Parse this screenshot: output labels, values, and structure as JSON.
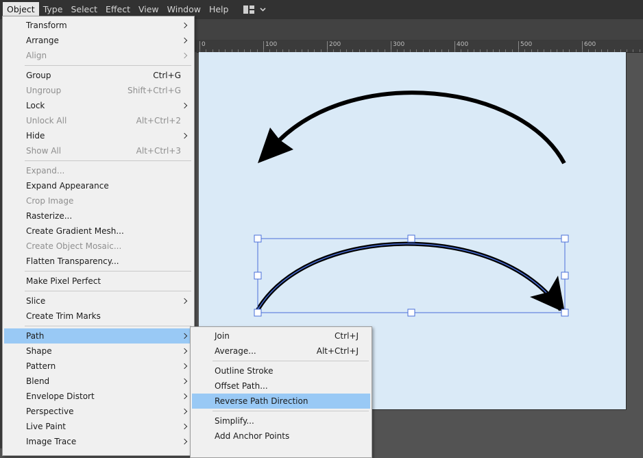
{
  "menubar": {
    "items": [
      "Object",
      "Type",
      "Select",
      "Effect",
      "View",
      "Window",
      "Help"
    ],
    "active": "Object"
  },
  "workspace_switcher_icon": "workspace-layout-icon",
  "ruler": {
    "ticks": [
      "0",
      "100",
      "200",
      "300",
      "400",
      "500",
      "600"
    ]
  },
  "object_menu": {
    "items": [
      {
        "label": "Transform",
        "shortcut": "",
        "submenu": true,
        "disabled": false
      },
      {
        "label": "Arrange",
        "shortcut": "",
        "submenu": true,
        "disabled": false
      },
      {
        "label": "Align",
        "shortcut": "",
        "submenu": true,
        "disabled": true
      },
      {
        "label": "Group",
        "shortcut": "Ctrl+G",
        "submenu": false,
        "disabled": false
      },
      {
        "label": "Ungroup",
        "shortcut": "Shift+Ctrl+G",
        "submenu": false,
        "disabled": true
      },
      {
        "label": "Lock",
        "shortcut": "",
        "submenu": true,
        "disabled": false
      },
      {
        "label": "Unlock All",
        "shortcut": "Alt+Ctrl+2",
        "submenu": false,
        "disabled": true
      },
      {
        "label": "Hide",
        "shortcut": "",
        "submenu": true,
        "disabled": false
      },
      {
        "label": "Show All",
        "shortcut": "Alt+Ctrl+3",
        "submenu": false,
        "disabled": true
      },
      {
        "label": "Expand...",
        "shortcut": "",
        "submenu": false,
        "disabled": true
      },
      {
        "label": "Expand Appearance",
        "shortcut": "",
        "submenu": false,
        "disabled": false
      },
      {
        "label": "Crop Image",
        "shortcut": "",
        "submenu": false,
        "disabled": true
      },
      {
        "label": "Rasterize...",
        "shortcut": "",
        "submenu": false,
        "disabled": false
      },
      {
        "label": "Create Gradient Mesh...",
        "shortcut": "",
        "submenu": false,
        "disabled": false
      },
      {
        "label": "Create Object Mosaic...",
        "shortcut": "",
        "submenu": false,
        "disabled": true
      },
      {
        "label": "Flatten Transparency...",
        "shortcut": "",
        "submenu": false,
        "disabled": false
      },
      {
        "label": "Make Pixel Perfect",
        "shortcut": "",
        "submenu": false,
        "disabled": false
      },
      {
        "label": "Slice",
        "shortcut": "",
        "submenu": true,
        "disabled": false
      },
      {
        "label": "Create Trim Marks",
        "shortcut": "",
        "submenu": false,
        "disabled": false
      },
      {
        "label": "Path",
        "shortcut": "",
        "submenu": true,
        "disabled": false,
        "highlighted": true
      },
      {
        "label": "Shape",
        "shortcut": "",
        "submenu": true,
        "disabled": false
      },
      {
        "label": "Pattern",
        "shortcut": "",
        "submenu": true,
        "disabled": false
      },
      {
        "label": "Blend",
        "shortcut": "",
        "submenu": true,
        "disabled": false
      },
      {
        "label": "Envelope Distort",
        "shortcut": "",
        "submenu": true,
        "disabled": false
      },
      {
        "label": "Perspective",
        "shortcut": "",
        "submenu": true,
        "disabled": false
      },
      {
        "label": "Live Paint",
        "shortcut": "",
        "submenu": true,
        "disabled": false
      },
      {
        "label": "Image Trace",
        "shortcut": "",
        "submenu": true,
        "disabled": false
      }
    ]
  },
  "path_menu": {
    "items": [
      {
        "label": "Join",
        "shortcut": "Ctrl+J",
        "disabled": false
      },
      {
        "label": "Average...",
        "shortcut": "Alt+Ctrl+J",
        "disabled": false
      },
      {
        "label": "Outline Stroke",
        "shortcut": "",
        "disabled": false
      },
      {
        "label": "Offset Path...",
        "shortcut": "",
        "disabled": false
      },
      {
        "label": "Reverse Path Direction",
        "shortcut": "",
        "disabled": false,
        "highlighted": true
      },
      {
        "label": "Simplify...",
        "shortcut": "",
        "disabled": false
      },
      {
        "label": "Add Anchor Points",
        "shortcut": "",
        "disabled": false
      }
    ]
  },
  "colors": {
    "menubar_bg": "#323232",
    "menu_bg": "#f0f0f0",
    "menu_highlight": "#99c9f5",
    "artboard_bg": "#daeaf7",
    "selection_blue": "#4a6fd8",
    "arrow_stroke": "#000000"
  },
  "icons": {
    "submenu_arrow": "chevron-right-icon",
    "workspace_dropdown": "chevron-down-icon"
  }
}
